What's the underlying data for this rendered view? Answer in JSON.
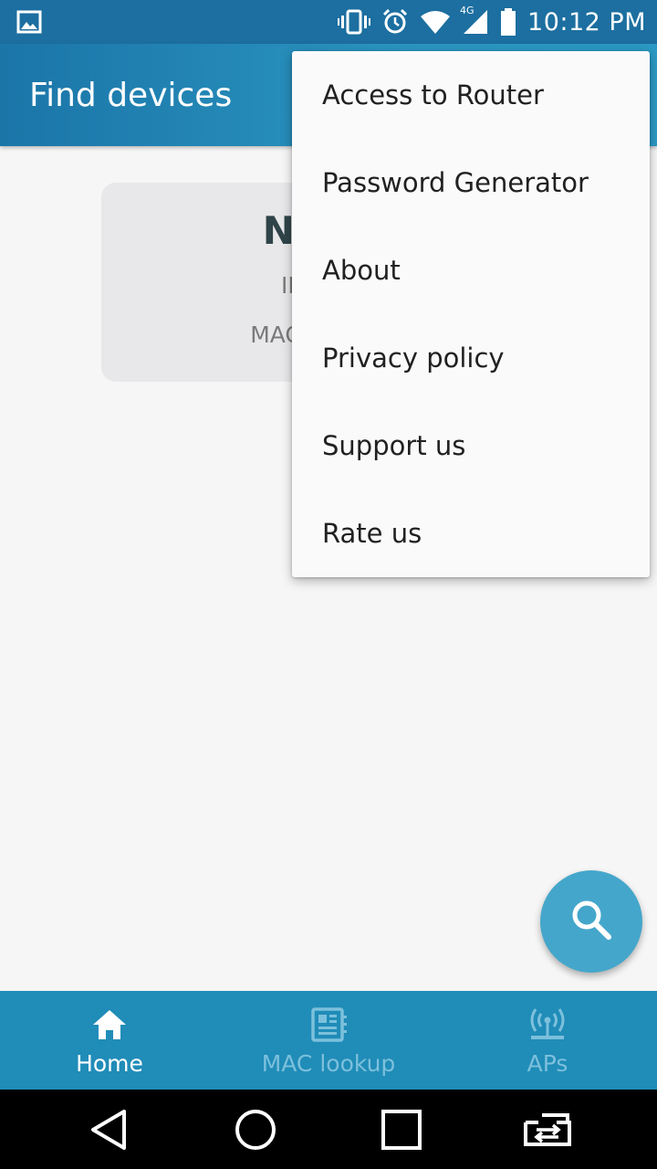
{
  "status_bar": {
    "time": "10:12 PM",
    "network_label": "4G",
    "icons": [
      "image-icon",
      "vibrate-icon",
      "alarm-icon",
      "wifi-icon",
      "signal-icon",
      "battery-icon"
    ]
  },
  "app_bar": {
    "title": "Find devices"
  },
  "device_card": {
    "name": "NET V",
    "ip_label": "IP Addre",
    "mac_label": "MAC Address:"
  },
  "overflow_menu": {
    "items": [
      {
        "label": "Access to Router"
      },
      {
        "label": "Password Generator"
      },
      {
        "label": "About"
      },
      {
        "label": "Privacy policy"
      },
      {
        "label": "Support us"
      },
      {
        "label": "Rate us"
      }
    ]
  },
  "fab": {
    "icon": "search-icon"
  },
  "bottom_nav": {
    "items": [
      {
        "label": "Home",
        "icon": "home-icon",
        "active": true
      },
      {
        "label": "MAC lookup",
        "icon": "chip-icon",
        "active": false
      },
      {
        "label": "APs",
        "icon": "access-point-icon",
        "active": false
      }
    ]
  },
  "colors": {
    "status_bar": "#1c6fa0",
    "app_bar": "#2a95c0",
    "bottom_nav": "#208cb8",
    "fab": "#45a6cb",
    "card": "#e8e8ea",
    "device_name": "#2f4448"
  },
  "system_nav": {
    "icons": [
      "back-icon",
      "home-circle-icon",
      "recents-icon",
      "switch-app-icon"
    ]
  }
}
